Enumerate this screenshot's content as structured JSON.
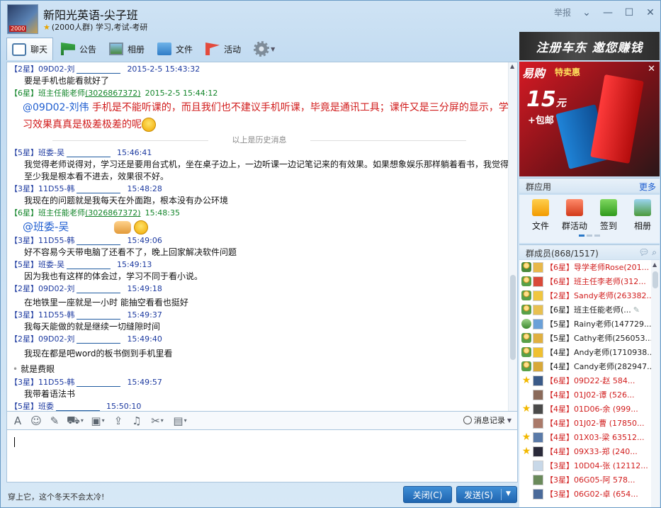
{
  "window": {
    "title": "新阳光英语-尖子班",
    "subtitle": "(2000人群) 学习,考试-考研",
    "report_label": "举报",
    "avatar_badge": "2000"
  },
  "toolbar": {
    "items": [
      {
        "label": "聊天",
        "icon": "chat-icon",
        "active": true
      },
      {
        "label": "公告",
        "icon": "notice-flag-icon"
      },
      {
        "label": "相册",
        "icon": "photo-icon"
      },
      {
        "label": "文件",
        "icon": "folder-icon"
      },
      {
        "label": "活动",
        "icon": "activity-flag-icon"
      }
    ]
  },
  "chat": {
    "history_separator": "以上是历史消息",
    "messages": [
      {
        "level": "【2星】",
        "name": "09D02-刘",
        "time": "2015-2-5 15:43:32",
        "body": "要是手机也能看就好了"
      },
      {
        "level": "【6星】",
        "name": "班主任能老师",
        "qq": "(3026867372)",
        "time": "2015-2-5 15:44:12",
        "teacher": true,
        "at": "@09D02-刘伟",
        "body": "手机是不能听课的，而且我们也不建议手机听课，毕竟是通讯工具；课件又是三分屏的显示，学习效果真真是极差极差的呢"
      },
      {
        "level": "【5星】",
        "name": "班委-吴",
        "time": "15:46:41",
        "body": "我觉得老师说得对，学习还是要用台式机，坐在桌子边上，一边听课一边记笔记来的有效果。如果想象娱乐那样躺着看书，我觉得至少我是根本看不进去，效果很不好。"
      },
      {
        "level": "【3星】",
        "name": "11D55-韩",
        "time": "15:48:28",
        "body": "我现在的问题就是我每天在外面跑，根本没有办公环境"
      },
      {
        "level": "【6星】",
        "name": "班主任能老师",
        "qq": "(3026867372)",
        "time": "15:48:35",
        "teacher": true,
        "at": "@班委-吴"
      },
      {
        "level": "【3星】",
        "name": "11D55-韩",
        "time": "15:49:06",
        "body": "好不容易今天带电脑了还看不了，晚上回家解决软件问题"
      },
      {
        "level": "【5星】",
        "name": "班委-吴",
        "time": "15:49:13",
        "body": "因为我也有这样的体会过，学习不同于看小说。"
      },
      {
        "level": "【2星】",
        "name": "09D02-刘",
        "time": "15:49:18",
        "body": "在地铁里一座就是一小时 能抽空看看也挺好"
      },
      {
        "level": "【3星】",
        "name": "11D55-韩",
        "time": "15:49:37",
        "body": "我每天能做的就是继续一切缝隙时间"
      },
      {
        "level": "【2星】",
        "name": "09D02-刘",
        "time": "15:49:40",
        "body": "我现在都是吧word的板书倒到手机里看"
      },
      {
        "bullet": "就是费眼"
      },
      {
        "level": "【3星】",
        "name": "11D55-韩",
        "time": "15:49:57",
        "body": "我带着语法书"
      },
      {
        "level": "【5星】",
        "name": "班委",
        "time": "15:50:10",
        "body": ""
      }
    ]
  },
  "input": {
    "history_label": "消息记录",
    "signature": "穿上它，这个冬天不会太冷!",
    "close_label": "关闭(C)",
    "send_label": "发送(S)"
  },
  "ads": {
    "top": "注册车东 邀您赚钱",
    "brand": "易购",
    "tag": "特卖惠",
    "price": "15",
    "price_unit": "元",
    "shipping": "+包邮"
  },
  "apps": {
    "title": "群应用",
    "more": "更多",
    "items": [
      {
        "label": "文件"
      },
      {
        "label": "群活动"
      },
      {
        "label": "签到"
      },
      {
        "label": "相册"
      }
    ]
  },
  "members": {
    "title": "群成员(868/1517)",
    "list": [
      {
        "text": "【6星】导学老师Rose(201...",
        "color": "red",
        "role": "owner"
      },
      {
        "text": "【6星】班主任李老师(312...",
        "color": "red",
        "role": "admin"
      },
      {
        "text": "【2星】Sandy老师(263382...",
        "color": "red",
        "role": "admin"
      },
      {
        "text": "【6星】班主任能老师(...",
        "color": "dark",
        "role": "admin"
      },
      {
        "text": "【5星】Rainy老师(147729...",
        "color": "dark",
        "role": "user"
      },
      {
        "text": "【5星】Cathy老师(256053...",
        "color": "dark",
        "role": "admin"
      },
      {
        "text": "【4星】Andy老师(1710938...",
        "color": "dark",
        "role": "admin"
      },
      {
        "text": "【4星】Candy老师(282947...",
        "color": "dark",
        "role": "admin"
      },
      {
        "text": "【6星】09D22-赵 584...",
        "color": "red",
        "role": "star"
      },
      {
        "text": "【4星】01J02-谭 (526...",
        "color": "red",
        "role": "none"
      },
      {
        "text": "【4星】01D06-余 (999...",
        "color": "red",
        "role": "star"
      },
      {
        "text": "【4星】01J02-曹 (17850...",
        "color": "red",
        "role": "none"
      },
      {
        "text": "【4星】01X03-梁 63512...",
        "color": "red",
        "role": "star"
      },
      {
        "text": "【4星】09X33-郑 (240...",
        "color": "red",
        "role": "star"
      },
      {
        "text": "【3星】10D04-张 (12112...",
        "color": "red",
        "role": "none"
      },
      {
        "text": "【3星】06G05-阿 578...",
        "color": "red",
        "role": "none"
      },
      {
        "text": "【3星】06G02-卓 (654...",
        "color": "red",
        "role": "none"
      }
    ]
  }
}
